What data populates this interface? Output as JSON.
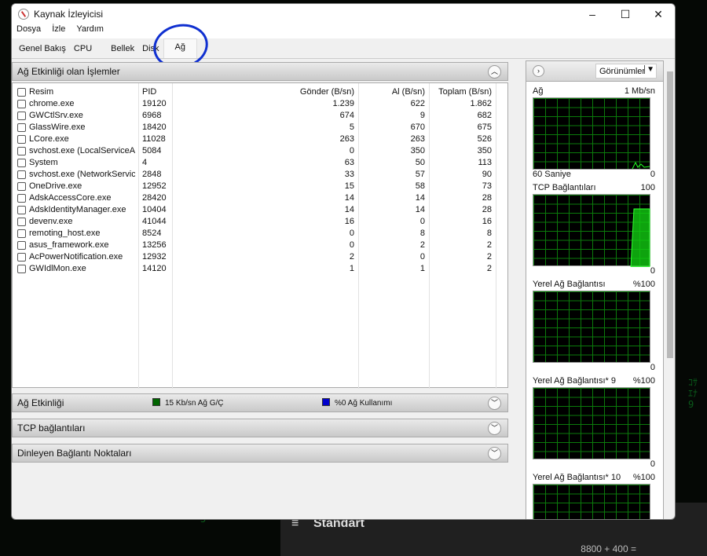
{
  "window": {
    "title": "Kaynak İzleyicisi",
    "minimize": "–",
    "maximize": "☐",
    "close": "✕"
  },
  "menu": [
    "Dosya",
    "İzle",
    "Yardım"
  ],
  "tabs": [
    "Genel Bakış",
    "CPU",
    "Bellek",
    "Disk",
    "Ağ"
  ],
  "processes": {
    "title": "Ağ Etkinliği olan İşlemler",
    "columns": [
      "Resim",
      "PID",
      "Gönder (B/sn)",
      "Al (B/sn)",
      "Toplam (B/sn)"
    ],
    "rows": [
      [
        "chrome.exe",
        "19120",
        "1.239",
        "622",
        "1.862"
      ],
      [
        "GWCtlSrv.exe",
        "6968",
        "674",
        "9",
        "682"
      ],
      [
        "GlassWire.exe",
        "18420",
        "5",
        "670",
        "675"
      ],
      [
        "LCore.exe",
        "11028",
        "263",
        "263",
        "526"
      ],
      [
        "svchost.exe (LocalServiceAndN...",
        "5084",
        "0",
        "350",
        "350"
      ],
      [
        "System",
        "4",
        "63",
        "50",
        "113"
      ],
      [
        "svchost.exe (NetworkService -p)",
        "2848",
        "33",
        "57",
        "90"
      ],
      [
        "OneDrive.exe",
        "12952",
        "15",
        "58",
        "73"
      ],
      [
        "AdskAccessCore.exe",
        "28420",
        "14",
        "14",
        "28"
      ],
      [
        "AdskIdentityManager.exe",
        "10404",
        "14",
        "14",
        "28"
      ],
      [
        "devenv.exe",
        "41044",
        "16",
        "0",
        "16"
      ],
      [
        "remoting_host.exe",
        "8524",
        "0",
        "8",
        "8"
      ],
      [
        "asus_framework.exe",
        "13256",
        "0",
        "2",
        "2"
      ],
      [
        "AcPowerNotification.exe",
        "12932",
        "2",
        "0",
        "2"
      ],
      [
        "GWIdlMon.exe",
        "14120",
        "1",
        "1",
        "2"
      ]
    ]
  },
  "sections": {
    "network": "Ağ Etkinliği",
    "io": "15 Kb/sn Ağ G/Ç",
    "usage": "%0 Ağ Kullanımı",
    "tcp": "TCP bağlantıları",
    "listen": "Dinleyen Bağlantı Noktaları"
  },
  "colors": {
    "io": "#006400",
    "usage": "#0000cc"
  },
  "right": {
    "views": "Görünümler",
    "graphs": [
      {
        "title": "Ağ",
        "max": "1 Mb/sn",
        "footer": "60 Saniye",
        "min": "0"
      },
      {
        "title": "TCP Bağlantıları",
        "max": "100",
        "footer": "",
        "min": "0"
      },
      {
        "title": "Yerel Ağ Bağlantısı",
        "max": "%100",
        "footer": "",
        "min": "0"
      },
      {
        "title": "Yerel Ağ Bağlantısı* 9",
        "max": "%100",
        "footer": "",
        "min": "0"
      },
      {
        "title": "Yerel Ağ Bağlantısı* 10",
        "max": "%100",
        "footer": "",
        "min": ""
      }
    ]
  },
  "calculator": {
    "title": "Standart",
    "expression": "8800 + 400 ="
  }
}
